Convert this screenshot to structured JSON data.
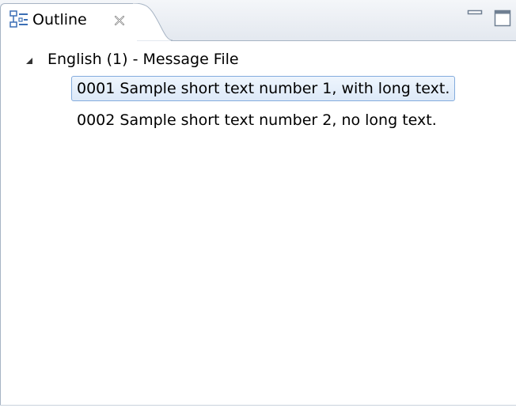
{
  "view": {
    "title": "Outline",
    "close_icon": "close-icon",
    "minimize_icon": "minimize-icon",
    "maximize_icon": "maximize-icon",
    "view_icon": "outline-view-icon"
  },
  "tree": {
    "root": {
      "label": "English (1) - Message File",
      "expanded": true,
      "children": [
        {
          "label": "0001 Sample short text number 1, with long text.",
          "selected": true
        },
        {
          "label": "0002 Sample short text number 2, no long text.",
          "selected": false
        }
      ]
    }
  },
  "colors": {
    "selection_border": "#84acdd",
    "selection_fill": "#e6effb",
    "frame_border": "#a7b4c4"
  }
}
